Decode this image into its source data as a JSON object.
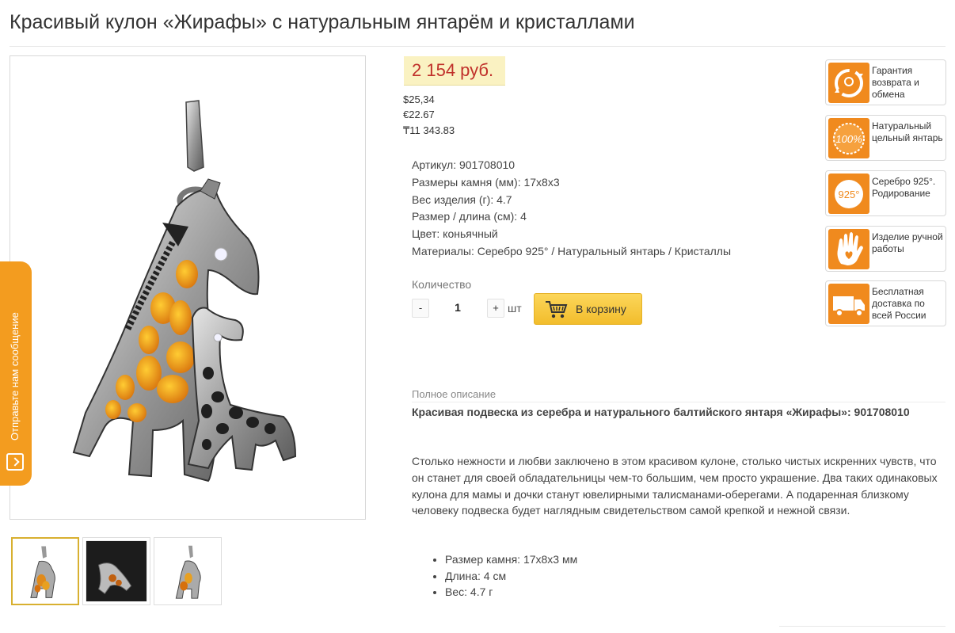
{
  "product": {
    "title": "Красивый кулон «Жирафы» с натуральным янтарём и кристаллами"
  },
  "price": {
    "main": "2 154 руб.",
    "usd": "$25,34",
    "eur": "€22.67",
    "kzt": "₸11 343.83"
  },
  "specs": [
    {
      "label": "Артикул:",
      "value": "901708010"
    },
    {
      "label": "Размеры камня (мм):",
      "value": "17x8x3"
    },
    {
      "label": "Вес изделия (г):",
      "value": "4.7"
    },
    {
      "label": "Размер / длина (см):",
      "value": "4"
    },
    {
      "label": "Цвет:",
      "value": "коньячный"
    },
    {
      "label": "Материалы:",
      "value": "Серебро 925° / Натуральный янтарь / Кристаллы"
    }
  ],
  "quantity": {
    "label": "Количество",
    "minus": "-",
    "value": "1",
    "plus": "+",
    "unit": "шт"
  },
  "cart": {
    "button_label": "В корзину"
  },
  "badges": [
    {
      "icon": "exchange-icon",
      "text": "Гарантия возврата и обмена"
    },
    {
      "icon": "amber-100-icon",
      "icon_text": "100%",
      "text": "Натуральный цельный янтарь"
    },
    {
      "icon": "silver-925-icon",
      "icon_text": "925°",
      "text": "Серебро 925°. Родирование"
    },
    {
      "icon": "hand-icon",
      "text": "Изделие ручной работы"
    },
    {
      "icon": "truck-icon",
      "text": "Бесплатная доставка по всей России"
    }
  ],
  "description": {
    "label": "Полное описание",
    "heading": "Красивая подвеска из серебра и натурального балтийского янтаря «Жирафы»: 901708010",
    "body": "Столько нежности и любви заключено в этом красивом кулоне, столько чистых искренних чувств, что он станет для своей обладательницы чем-то большим, чем просто украшение. Два таких одинаковых кулона для мамы и дочки станут ювелирными талисманами-оберегами. А подаренная близкому человеку подвеска будет наглядным свидетельством самой крепкой и нежной связи.",
    "list": [
      "Размер камня: 17x8x3 мм",
      "Длина: 4 см",
      "Вес: 4.7 г"
    ]
  },
  "feedback": {
    "label": "Отправьте нам сообщение"
  },
  "colors": {
    "accent_orange": "#f08a1e",
    "price_red": "#c0302a",
    "cart_yellow": "#f7c842"
  }
}
